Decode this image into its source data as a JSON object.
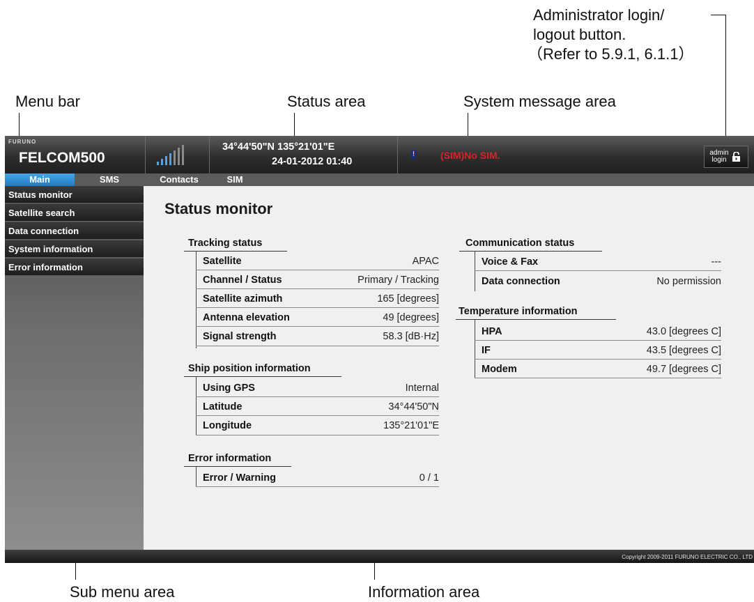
{
  "callouts": {
    "admin": [
      "Administrator login/",
      "logout button.",
      "（Refer to 5.9.1, 6.1.1）"
    ],
    "menu_bar": "Menu bar",
    "status_area": "Status area",
    "system_message_area": "System message area",
    "sub_menu_area": "Sub menu area",
    "information_area": "Information area"
  },
  "header": {
    "brand_small": "FURUNO",
    "brand": "FELCOM500",
    "signal_bars_lit": 4,
    "signal_bars_total": 7,
    "position": "34°44'50\"N  135°21'01\"E",
    "datetime": "24-01-2012 01:40",
    "warning_icon": "!",
    "system_message": "(SIM)No SIM.",
    "admin_button": {
      "line1": "admin",
      "line2": "login",
      "icon": "unlocked-padlock-icon"
    },
    "colors": {
      "message": "#d9222a",
      "active_menu": "#2b8bd0",
      "warning": "#ffd400"
    }
  },
  "menu": {
    "items": [
      {
        "label": "Main",
        "active": true
      },
      {
        "label": "SMS",
        "active": false
      },
      {
        "label": "Contacts",
        "active": false
      },
      {
        "label": "SIM",
        "active": false
      }
    ]
  },
  "submenu": {
    "items": [
      "Status monitor",
      "Satellite search",
      "Data connection",
      "System information",
      "Error information"
    ]
  },
  "info": {
    "title": "Status monitor",
    "tracking": {
      "title": "Tracking status",
      "rows": [
        {
          "label": "Satellite",
          "value": "APAC"
        },
        {
          "label": "Channel / Status",
          "value": "Primary / Tracking"
        },
        {
          "label": "Satellite azimuth",
          "value": "165 [degrees]"
        },
        {
          "label": "Antenna elevation",
          "value": "49 [degrees]"
        },
        {
          "label": "Signal strength",
          "value": "58.3 [dB·Hz]"
        }
      ]
    },
    "ship_position": {
      "title": "Ship position information",
      "rows": [
        {
          "label": "Using GPS",
          "value": "Internal"
        },
        {
          "label": "Latitude",
          "value": "34°44'50\"N"
        },
        {
          "label": "Longitude",
          "value": "135°21'01\"E"
        }
      ]
    },
    "error": {
      "title": "Error information",
      "rows": [
        {
          "label": "Error / Warning",
          "value": "0 / 1"
        }
      ]
    },
    "communication": {
      "title": "Communication status",
      "rows": [
        {
          "label": "Voice & Fax",
          "value": "---"
        },
        {
          "label": "Data connection",
          "value": "No permission"
        }
      ]
    },
    "temperature": {
      "title": "Temperature information",
      "rows": [
        {
          "label": "HPA",
          "value": "43.0 [degrees C]"
        },
        {
          "label": "IF",
          "value": "43.5 [degrees C]"
        },
        {
          "label": "Modem",
          "value": "49.7 [degrees C]"
        }
      ]
    }
  },
  "footer": {
    "copyright": "Copyright 2009-2011 FURUNO ELECTRIC CO., LTD"
  }
}
